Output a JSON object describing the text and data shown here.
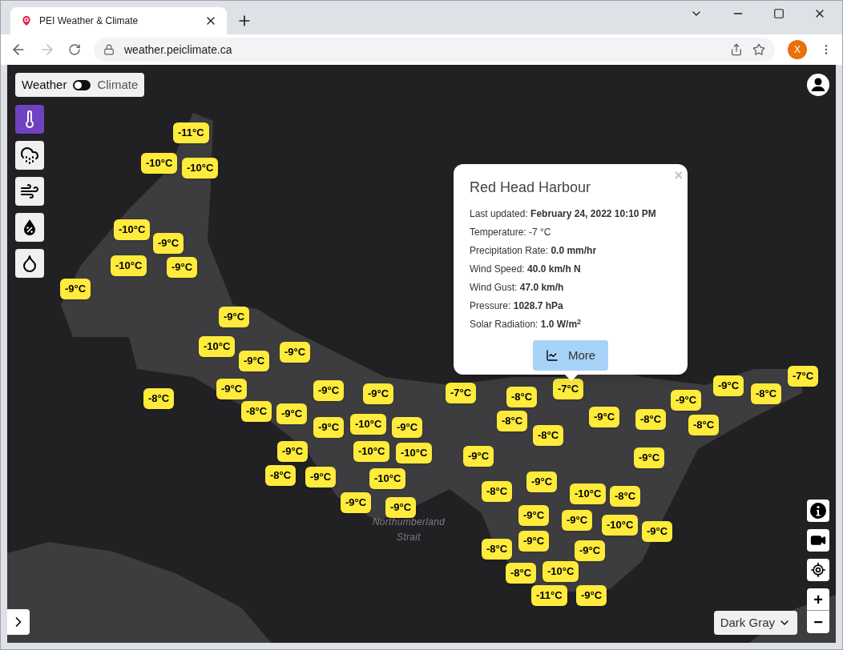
{
  "browser": {
    "tab_title": "PEI Weather & Climate",
    "url": "weather.peiclimate.ca",
    "profile_initial": "X"
  },
  "mode_toggle": {
    "left_label": "Weather",
    "right_label": "Climate",
    "on": false
  },
  "layers": [
    {
      "kind": "temperature",
      "selected": true
    },
    {
      "kind": "precipitation",
      "selected": false
    },
    {
      "kind": "wind",
      "selected": false
    },
    {
      "kind": "humidity",
      "selected": false
    },
    {
      "kind": "dewpoint",
      "selected": false
    }
  ],
  "map_labels": [
    "Northumberland Strait"
  ],
  "markers": [
    {
      "reading": "-11°C"
    },
    {
      "reading": "-10°C"
    },
    {
      "reading": "-10°C"
    },
    {
      "reading": "-10°C"
    },
    {
      "reading": "-9°C"
    },
    {
      "reading": "-10°C"
    },
    {
      "reading": "-9°C"
    },
    {
      "reading": "-9°C"
    },
    {
      "reading": "-9°C"
    },
    {
      "reading": "-10°C"
    },
    {
      "reading": "-9°C"
    },
    {
      "reading": "-9°C"
    },
    {
      "reading": "-8°C"
    },
    {
      "reading": "-9°C"
    },
    {
      "reading": "-8°C"
    },
    {
      "reading": "-9°C"
    },
    {
      "reading": "-9°C"
    },
    {
      "reading": "-9°C"
    },
    {
      "reading": "-7°C"
    },
    {
      "reading": "-8°C"
    },
    {
      "reading": "-7°C"
    },
    {
      "reading": "-9°C"
    },
    {
      "reading": "-8°C"
    },
    {
      "reading": "-9°C"
    },
    {
      "reading": "-9°C"
    },
    {
      "reading": "-8°C"
    },
    {
      "reading": "-7°C"
    },
    {
      "reading": "-8°C"
    },
    {
      "reading": "-8°C"
    },
    {
      "reading": "-8°C"
    },
    {
      "reading": "-9°C"
    },
    {
      "reading": "-9°C"
    },
    {
      "reading": "-10°C"
    },
    {
      "reading": "-9°C"
    },
    {
      "reading": "-9°C"
    },
    {
      "reading": "-10°C"
    },
    {
      "reading": "-10°C"
    },
    {
      "reading": "-9°C"
    },
    {
      "reading": "-8°C"
    },
    {
      "reading": "-9°C"
    },
    {
      "reading": "-10°C"
    },
    {
      "reading": "-9°C"
    },
    {
      "reading": "-9°C"
    },
    {
      "reading": "-9°C"
    },
    {
      "reading": "-8°C"
    },
    {
      "reading": "-10°C"
    },
    {
      "reading": "-8°C"
    },
    {
      "reading": "-9°C"
    },
    {
      "reading": "-9°C"
    },
    {
      "reading": "-10°C"
    },
    {
      "reading": "-9°C"
    },
    {
      "reading": "-9°C"
    },
    {
      "reading": "-8°C"
    },
    {
      "reading": "-9°C"
    },
    {
      "reading": "-8°C"
    },
    {
      "reading": "-10°C"
    },
    {
      "reading": "-11°C"
    },
    {
      "reading": "-9°C"
    }
  ],
  "popup": {
    "title": "Red Head Harbour",
    "close": "×",
    "fields": [
      {
        "label": "Last updated:",
        "value": "February 24, 2022 10:10 PM"
      },
      {
        "label": "Temperature:",
        "value": "-7 °C",
        "plain": true
      },
      {
        "label": "Precipitation Rate:",
        "value": "0.0 mm/hr"
      },
      {
        "label": "Wind Speed:",
        "value": "40.0 km/h N"
      },
      {
        "label": "Wind Gust:",
        "value": "47.0 km/h"
      },
      {
        "label": "Pressure:",
        "value": "1028.7 hPa"
      },
      {
        "label": "Solar Radiation:",
        "value": "1.0 W/m$^{2}$"
      }
    ],
    "button": "More"
  },
  "zoom": {
    "in": "+",
    "out": "−"
  },
  "basemap": {
    "value": "Dark Gray"
  }
}
